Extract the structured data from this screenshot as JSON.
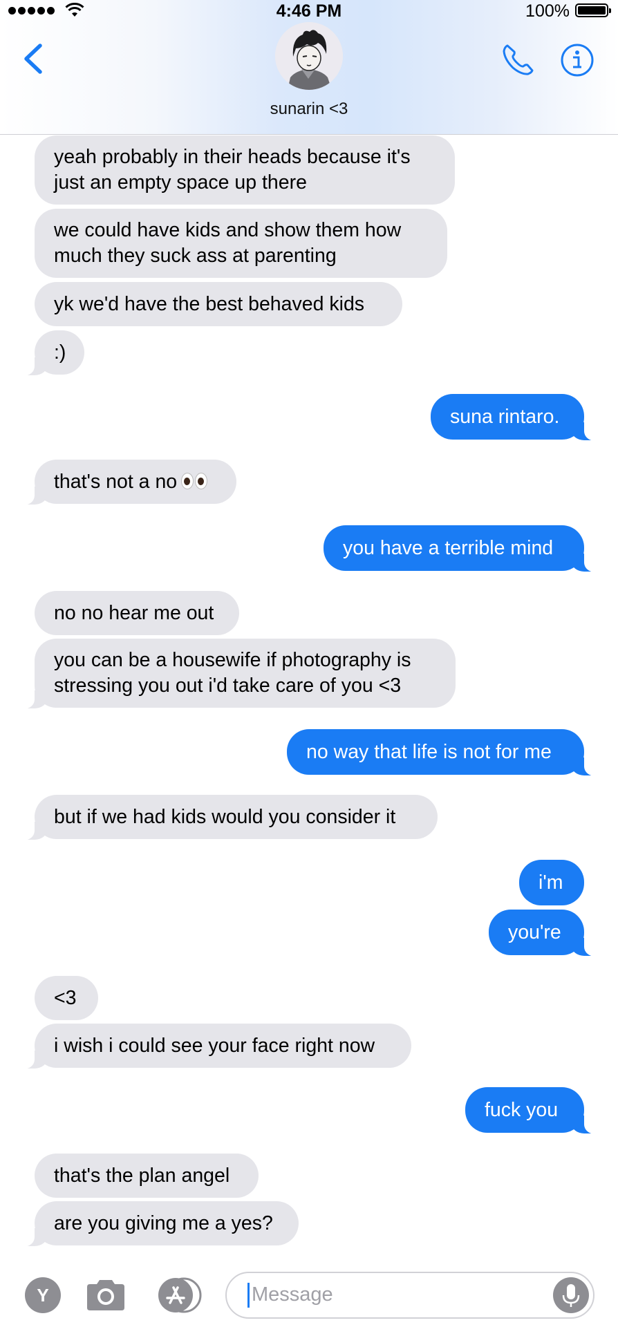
{
  "status_bar": {
    "time": "4:46 PM",
    "battery_percent": "100%"
  },
  "header": {
    "contact_name": "sunarin <3",
    "icons": {
      "back": "chevron-left-icon",
      "call": "phone-icon",
      "info": "info-icon"
    }
  },
  "colors": {
    "outgoing_bubble": "#1a7cf4",
    "incoming_bubble": "#e5e5ea",
    "accent": "#1a7cf4"
  },
  "messages": [
    {
      "sender": "them",
      "text": "yeah probably in their heads because it's just an empty space up there"
    },
    {
      "sender": "them",
      "text": "we could have kids and show them how much they suck ass at parenting"
    },
    {
      "sender": "them",
      "text": "yk we'd have the best behaved kids"
    },
    {
      "sender": "them",
      "text": ":)"
    },
    {
      "sender": "me",
      "text": "suna rintaro."
    },
    {
      "sender": "them",
      "text": "that's not a no",
      "emoji": "eyes"
    },
    {
      "sender": "me",
      "text": "you have a terrible mind"
    },
    {
      "sender": "them",
      "text": "no no hear me out"
    },
    {
      "sender": "them",
      "text": "you can be a housewife if photography is stressing you out i'd take care of you <3"
    },
    {
      "sender": "me",
      "text": "no way that life is not for me"
    },
    {
      "sender": "them",
      "text": "but if we had kids would you consider it"
    },
    {
      "sender": "me",
      "text": "i'm"
    },
    {
      "sender": "me",
      "text": "you're"
    },
    {
      "sender": "them",
      "text": "<3"
    },
    {
      "sender": "them",
      "text": "i wish i could see your face right now"
    },
    {
      "sender": "me",
      "text": "fuck you"
    },
    {
      "sender": "them",
      "text": "that's the plan angel"
    },
    {
      "sender": "them",
      "text": "are you giving me a yes?"
    }
  ],
  "input_bar": {
    "app_button_label": "Y",
    "placeholder": "Message",
    "icons": {
      "camera": "camera-icon",
      "app_store": "app-store-icon",
      "microphone": "microphone-icon"
    }
  }
}
